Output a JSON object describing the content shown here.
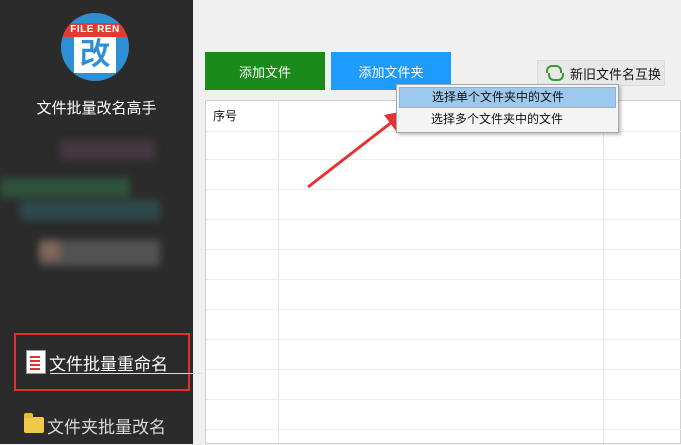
{
  "sidebar": {
    "logo_text": "FILE REN",
    "logo_glyph": "改",
    "app_title": "文件批量改名高手",
    "nav": [
      {
        "label": "文件批量重命名",
        "icon": "document-icon"
      },
      {
        "label": "文件夹批量改名",
        "icon": "folder-icon"
      }
    ]
  },
  "toolbar": {
    "add_file_label": "添加文件",
    "add_folder_label": "添加文件夹",
    "swap_label": "新旧文件名互换",
    "swap_icon": "refresh-icon"
  },
  "table": {
    "headers": [
      "序号"
    ]
  },
  "dropdown": {
    "items": [
      "选择单个文件夹中的文件",
      "选择多个文件夹中的文件"
    ]
  },
  "colors": {
    "sidebar_bg": "#2b2b2b",
    "add_file": "#1a8a1a",
    "add_folder": "#1e9bff",
    "highlight": "#e03030",
    "arrow": "#e53333"
  }
}
